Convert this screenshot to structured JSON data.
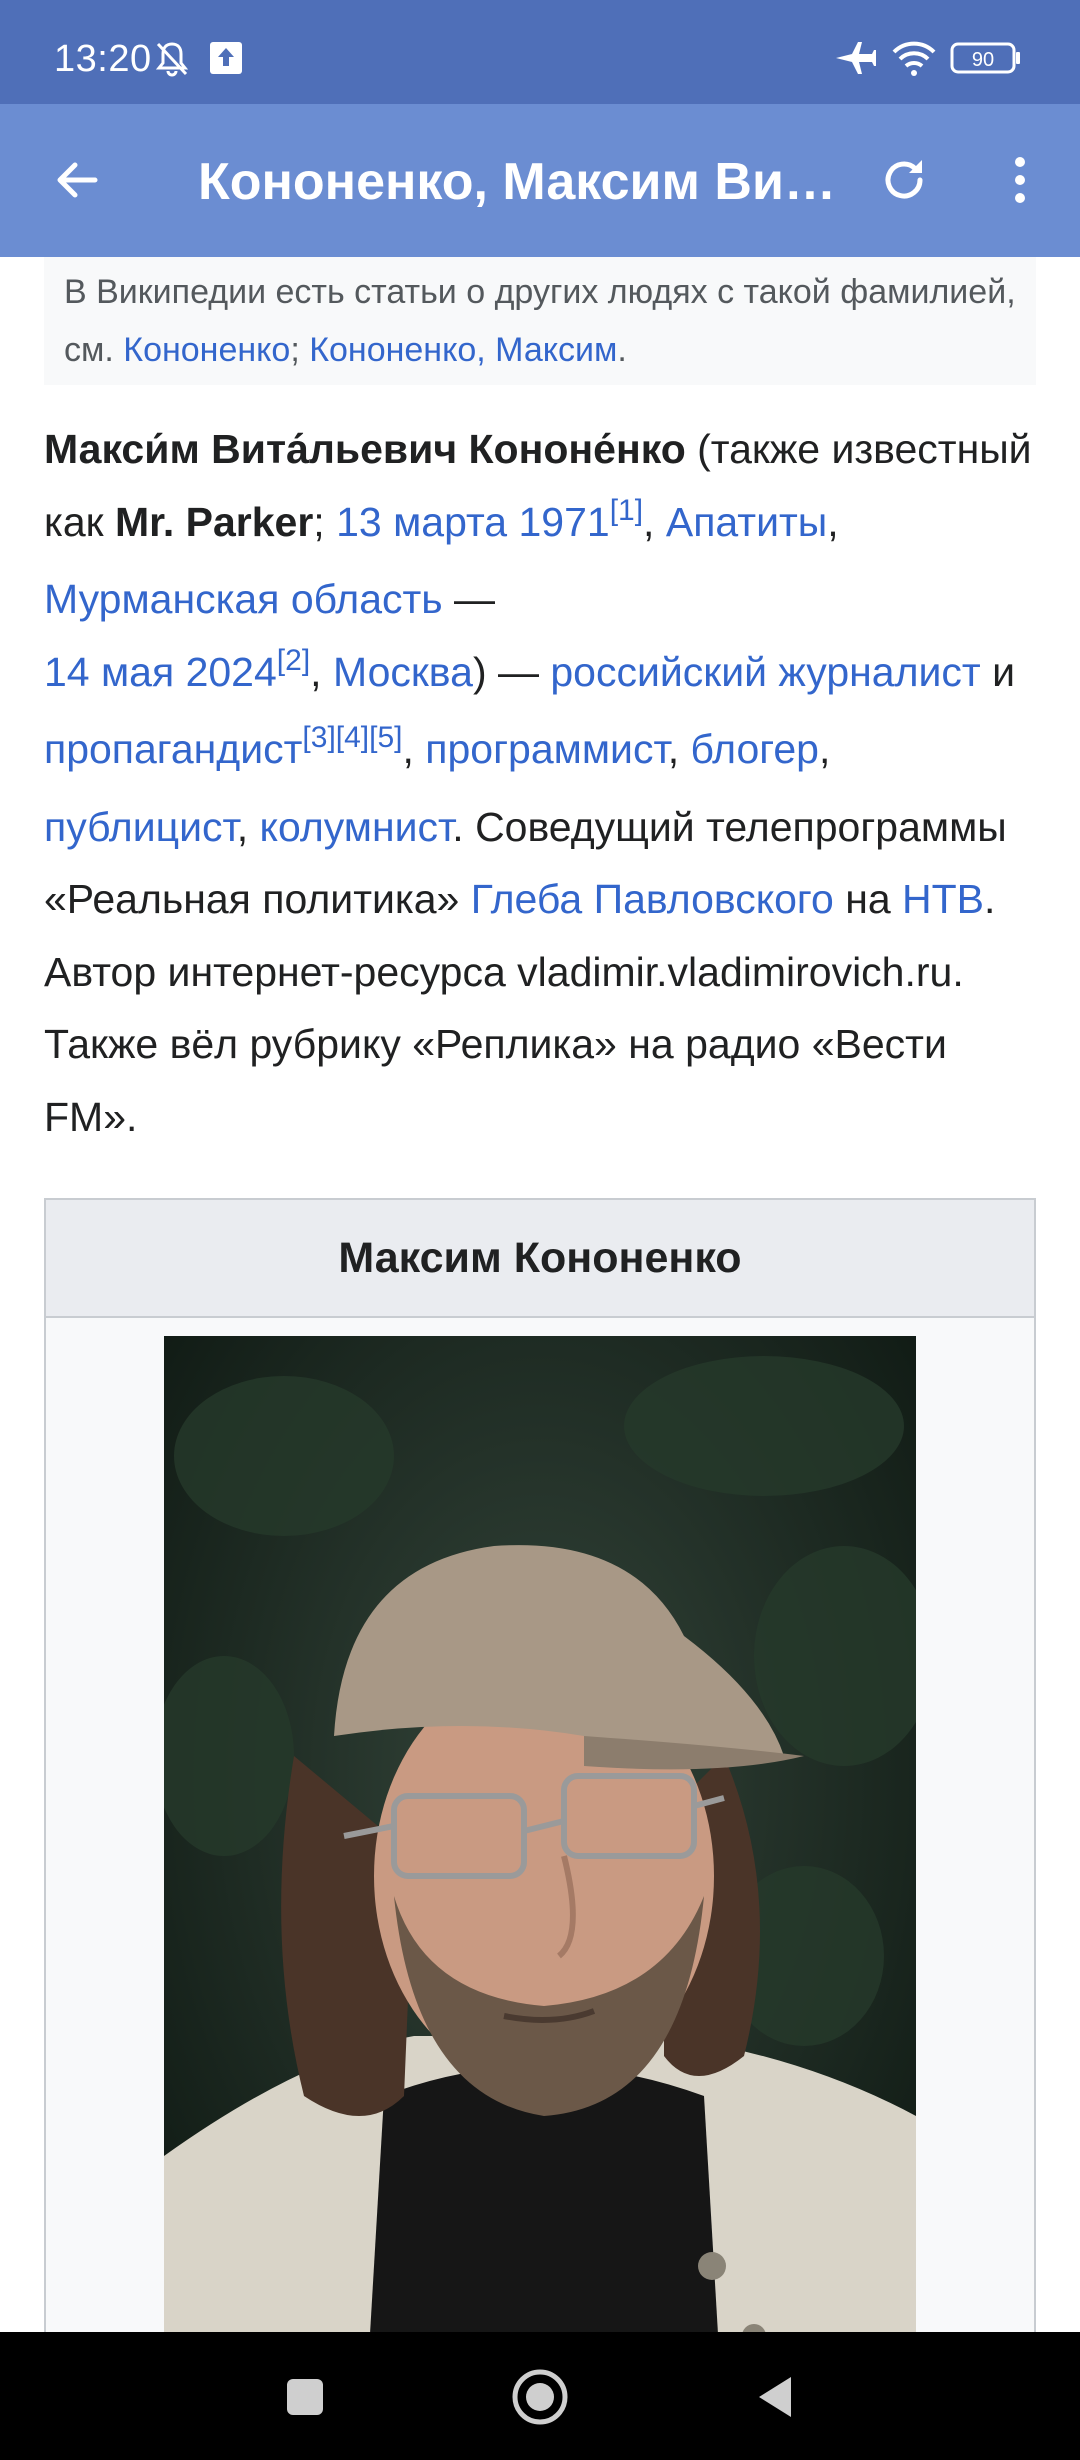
{
  "status_bar": {
    "time": "13:20",
    "battery": "90",
    "icons": [
      "mute-icon",
      "upload-icon",
      "airplane-icon",
      "wifi-icon",
      "battery-icon"
    ]
  },
  "app_bar": {
    "title": "Кононенко, Максим Витальевич",
    "icons": [
      "back-arrow-icon",
      "refresh-icon",
      "more-vert-icon"
    ]
  },
  "hatnote": {
    "text": "В Википедии есть статьи о других людях с такой фамилией, см. ",
    "link1": "Кононенко",
    "sep": "; ",
    "link2": "Кононенко, Максим",
    "end": "."
  },
  "lead": {
    "name": "Макси́м Вита́льевич Кононе́нко",
    "t1": " (также известный как ",
    "alias": "Mr. Parker",
    "t2": "; ",
    "birth_date": "13 марта 1971",
    "ref1": "[1]",
    "t3": ", ",
    "birth_city": "Апатиты",
    "t4": ", ",
    "birth_region": "Мурманская область",
    "t5": " — ",
    "death_date": "14 мая 2024",
    "ref2": "[2]",
    "t6": ", ",
    "death_city": "Москва",
    "t7": ") — ",
    "occ1": "российский журналист",
    "t8": " и ",
    "occ2": "пропагандист",
    "ref3": "[3]",
    "ref4": "[4]",
    "ref5": "[5]",
    "t9": ", ",
    "occ3": "программист",
    "t10": ", ",
    "occ4": "блогер",
    "t11": ", ",
    "occ5": "публицист",
    "t12": ", ",
    "occ6": "колумнист",
    "t13": ". Соведущий телепрограммы «Реальная политика» ",
    "host": "Глеба Павловского",
    "t14": " на ",
    "channel": "НТВ",
    "t15": ". Автор интернет-ресурса vladimir.vladimirovich.ru. Также вёл рубрику «Реплика» на радио «Вести FM»."
  },
  "infobox": {
    "title": "Максим Кононенко"
  },
  "nav_bar": {
    "icons": [
      "recents-square-icon",
      "home-circle-icon",
      "back-triangle-icon"
    ]
  }
}
